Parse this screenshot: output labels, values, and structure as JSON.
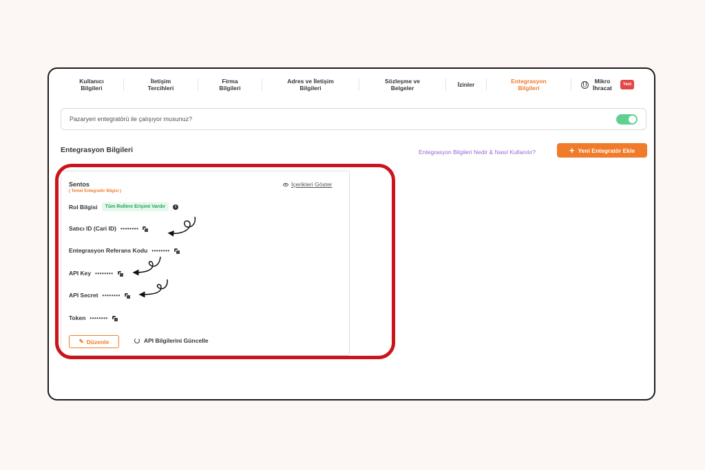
{
  "tabs": [
    {
      "line1": "Kullanıcı",
      "line2": "Bilgileri"
    },
    {
      "line1": "İletişim",
      "line2": "Tercihleri"
    },
    {
      "line1": "Firma",
      "line2": "Bilgileri"
    },
    {
      "line1": "Adres ve İletişim",
      "line2": "Bilgileri"
    },
    {
      "line1": "Sözleşme ve",
      "line2": "Belgeler"
    },
    {
      "line1": "İzinler",
      "line2": ""
    },
    {
      "line1": "Entegrasyon",
      "line2": "Bilgileri"
    }
  ],
  "special_tab": {
    "line1": "Mikro",
    "line2": "İhracat",
    "badge": "Yeni",
    "icon": "globe-icon"
  },
  "question": {
    "text": "Pazaryeri entegratörü ile çalışıyor musunuz?",
    "toggle_on": true
  },
  "section": {
    "title": "Entegrasyon Bilgileri",
    "help_link": "Entegrasyon Bilgileri Nedir & Nasıl Kullanılır?",
    "add_button": "Yeni Entegratör Ekle"
  },
  "card": {
    "name": "Sentos",
    "subtitle": "( Temel Entegratör Bilgisi )",
    "show_link": "İçerikleri Göster",
    "role_label": "Rol Bilgisi",
    "role_badge": "Tüm Rollere Erişimi Vardır",
    "fields": [
      {
        "label": "Satıcı ID (Cari ID)",
        "masked": "••••••••"
      },
      {
        "label": "Entegrasyon Referans Kodu",
        "masked": "••••••••"
      },
      {
        "label": "API Key",
        "masked": "••••••••"
      },
      {
        "label": "API Secret",
        "masked": "••••••••"
      },
      {
        "label": "Token",
        "masked": "••••••••"
      }
    ],
    "edit_button": "Düzenle",
    "update_link": "API Bilgilerini Güncelle"
  },
  "colors": {
    "accent": "#f07b2a",
    "highlight": "#cc141b",
    "toggle": "#5fd18e",
    "link": "#8f6ad9"
  }
}
